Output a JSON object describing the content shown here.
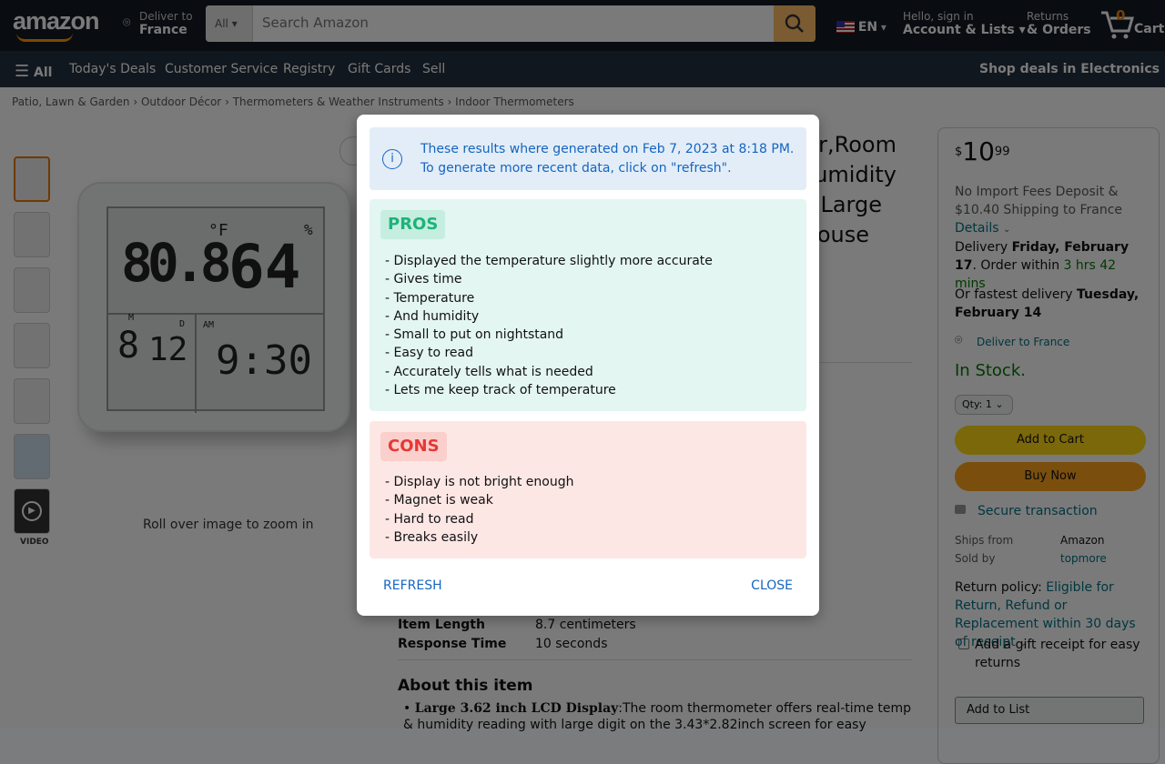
{
  "header": {
    "logo": "amazon",
    "deliver_label": "Deliver to",
    "deliver_location": "France",
    "search_category": "All",
    "search_placeholder": "Search Amazon",
    "language": "EN",
    "account_greeting": "Hello, sign in",
    "account_label": "Account & Lists",
    "returns_label": "Returns",
    "orders_label": "& Orders",
    "cart_count": "0",
    "cart_label": "Cart"
  },
  "subnav": {
    "all": "All",
    "items": [
      "Today's Deals",
      "Customer Service",
      "Registry",
      "Gift Cards",
      "Sell"
    ],
    "promo": "Shop deals in Electronics"
  },
  "breadcrumb": [
    "Patio, Lawn & Garden",
    "Outdoor Décor",
    "Thermometers & Weather Instruments",
    "Indoor Thermometers"
  ],
  "gallery": {
    "video_label": "VIDEO",
    "zoom_hint": "Roll over image to zoom in",
    "display": {
      "temp": "80.8",
      "unit": "°F",
      "humidity": "64",
      "humidity_unit": "%",
      "month_label": "M",
      "month": "8",
      "day_label": "D",
      "day": "12",
      "ampm": "AM",
      "time": "9:30"
    }
  },
  "product": {
    "title_fragments": [
      "er,Room",
      "umidity",
      "Large",
      "ouse"
    ],
    "specs": [
      {
        "k": "Item Length",
        "v": "8.7 centimeters"
      },
      {
        "k": "Response Time",
        "v": "10 seconds"
      }
    ],
    "about_title": "About this item",
    "about_bullet_bold": "Large 3.62 inch LCD Display",
    "about_bullet_text": ":The room thermometer offers real-time temp & humidity reading with large digit on the 3.43*2.82inch screen for easy"
  },
  "buybox": {
    "price_symbol": "$",
    "price_whole": "10",
    "price_fraction": "99",
    "shipping": "No Import Fees Deposit & $10.40 Shipping to France",
    "details": "Details",
    "delivery_prefix": "Delivery ",
    "delivery_date": "Friday, February 17",
    "order_within_prefix": "Order within ",
    "order_within": "3 hrs 42 mins",
    "fastest_prefix": "Or fastest delivery ",
    "fastest_date": "Tuesday, February 14",
    "deliver_to": "Deliver to France",
    "stock": "In Stock.",
    "qty": "Qty: 1",
    "add_to_cart": "Add to Cart",
    "buy_now": "Buy Now",
    "secure": "Secure transaction",
    "ships_from_label": "Ships from",
    "ships_from": "Amazon",
    "sold_by_label": "Sold by",
    "sold_by": "topmore",
    "return_prefix": "Return policy: ",
    "return_link": "Eligible for Return, Refund or Replacement within 30 days of receipt",
    "gift_receipt": "Add a gift receipt for easy returns",
    "add_to_list": "Add to List"
  },
  "modal": {
    "info_line1": "These results where generated on Feb 7, 2023 at 8:18 PM.",
    "info_line2": "To generate more recent data, click on \"refresh\".",
    "pros_title": "PROS",
    "pros": [
      "- Displayed the temperature slightly more accurate",
      "- Gives time",
      "- Temperature",
      "- And humidity",
      "- Small to put on nightstand",
      "- Easy to read",
      "- Accurately tells what is needed",
      "- Lets me keep track of temperature"
    ],
    "cons_title": "CONS",
    "cons": [
      "- Display is not bright enough",
      "- Magnet is weak",
      "- Hard to read",
      "- Breaks easily"
    ],
    "refresh": "REFRESH",
    "close": "CLOSE",
    "colors": {
      "info_bg": "#e3edf8",
      "info_text": "#1565c0",
      "pros_bg": "#e3f6f1",
      "pros_text": "#1db37a",
      "cons_bg": "#fde7e5",
      "cons_text": "#e53935"
    }
  }
}
